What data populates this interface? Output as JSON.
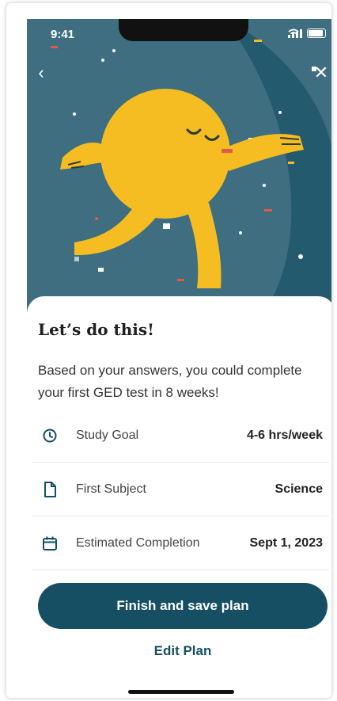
{
  "status_bar": {
    "time": "9:41"
  },
  "hero": {
    "back_icon": "‹",
    "close_icon": "✕"
  },
  "sheet": {
    "title": "Let’s do this!",
    "description": "Based on your answers, you could complete your first GED test in 8 weeks!",
    "plan_items": [
      {
        "icon": "clock-icon",
        "label": "Study Goal",
        "value": "4-6 hrs/week"
      },
      {
        "icon": "document-icon",
        "label": "First Subject",
        "value": "Science"
      },
      {
        "icon": "calendar-icon",
        "label": "Estimated Completion",
        "value": "Sept 1, 2023"
      }
    ],
    "primary_button": "Finish and save plan",
    "secondary_link": "Edit Plan"
  },
  "colors": {
    "accent": "#164f63",
    "hero_bg": "#3e6e80",
    "mascot": "#f6bd23"
  }
}
